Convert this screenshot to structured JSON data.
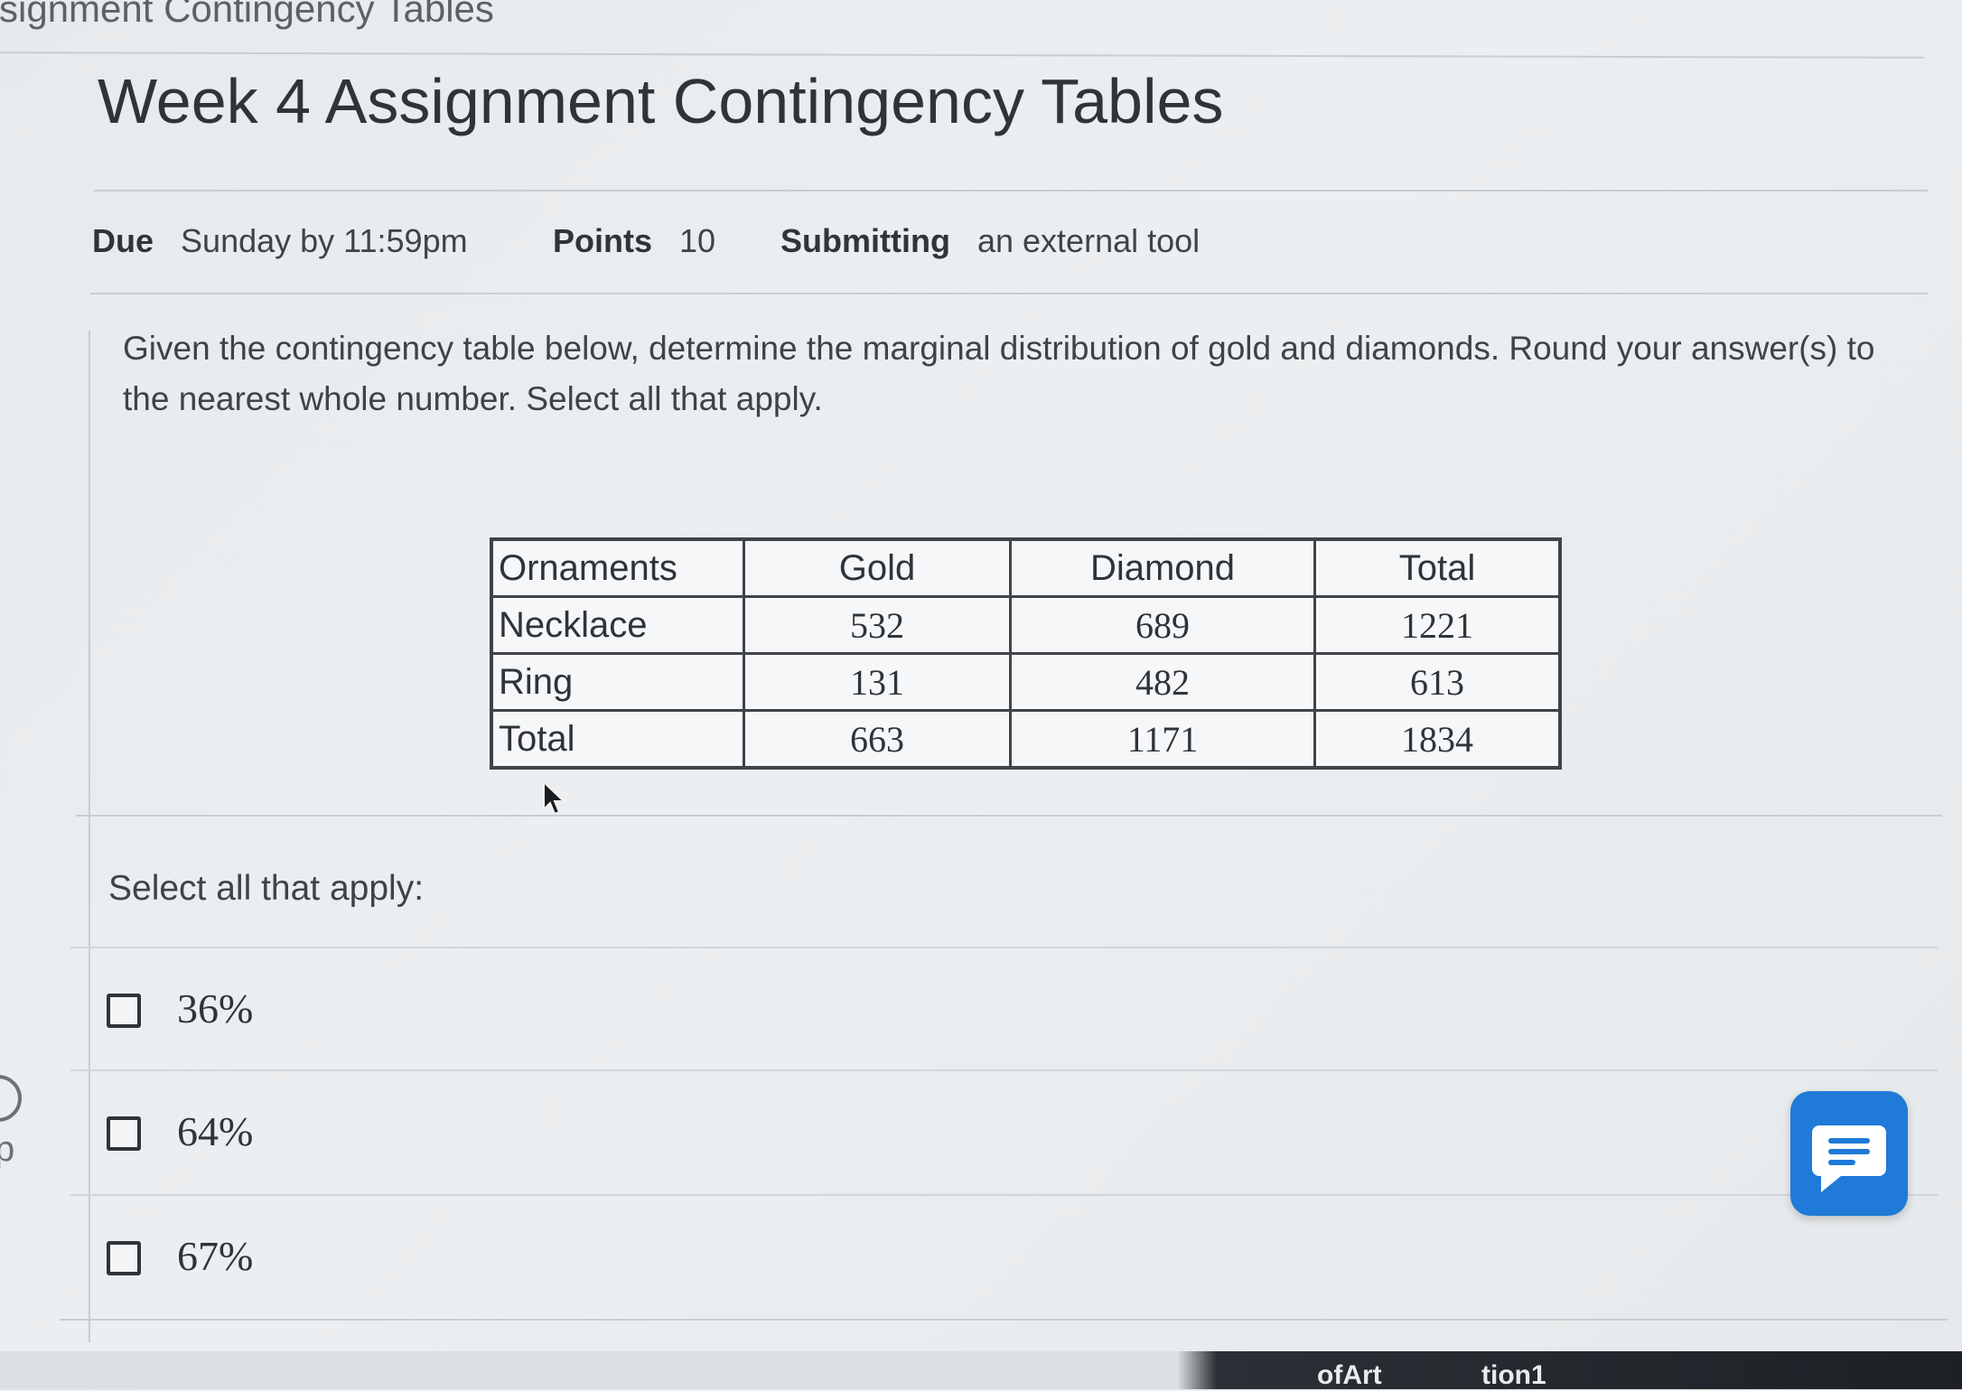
{
  "breadcrumb": "ssignment Contingency Tables",
  "page_title": "Week 4 Assignment Contingency Tables",
  "meta": {
    "due_label": "Due",
    "due_value": "Sunday by 11:59pm",
    "points_label": "Points",
    "points_value": "10",
    "submitting_label": "Submitting",
    "submitting_value": "an external tool"
  },
  "question": {
    "text": "Given the contingency table below, determine the marginal distribution of gold and diamonds. Round your answer(s) to the nearest whole number. Select all that apply."
  },
  "table": {
    "headers": [
      "Ornaments",
      "Gold",
      "Diamond",
      "Total"
    ],
    "rows": [
      [
        "Necklace",
        "532",
        "689",
        "1221"
      ],
      [
        "Ring",
        "131",
        "482",
        "613"
      ],
      [
        "Total",
        "663",
        "1171",
        "1834"
      ]
    ]
  },
  "select_label": "Select all that apply:",
  "options": [
    {
      "label": "36%",
      "checked": false
    },
    {
      "label": "64%",
      "checked": false
    },
    {
      "label": "67%",
      "checked": false
    }
  ],
  "chat_button": {
    "icon": "chat-icon",
    "color": "#1f7ad8"
  },
  "left_edge": {
    "letter": "p"
  },
  "bottom_tabs": [
    "ofArt",
    "tion1"
  ]
}
